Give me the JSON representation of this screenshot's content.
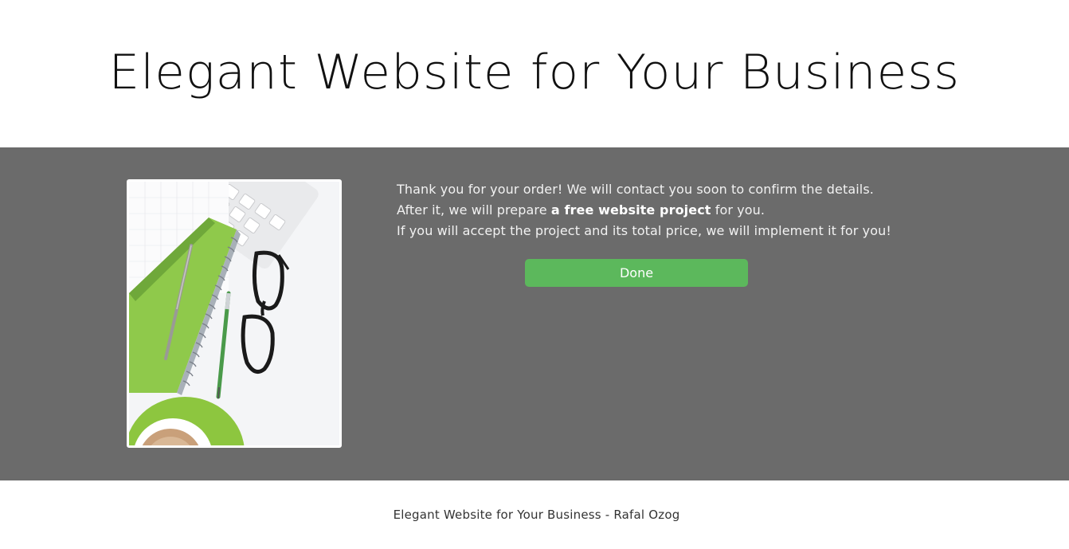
{
  "header": {
    "title": "Elegant Website for Your Business"
  },
  "main": {
    "message": {
      "line1": "Thank you for your order! We will contact you soon to confirm the details.",
      "line2_before": "After it, we will prepare ",
      "line2_bold": "a free website project",
      "line2_after": " for you.",
      "line3": "If you will accept the project and its total price, we will implement it for you!"
    },
    "done_button_label": "Done",
    "image": {
      "subject": "desk-photo-notebook-keyboard-glasses-pens-coffee"
    }
  },
  "footer": {
    "text": "Elegant Website for Your Business - Rafal Ozog"
  },
  "colors": {
    "main_background": "#6b6b6b",
    "button": "#5cb85c",
    "header_background": "#ffffff",
    "footer_text": "#333333"
  }
}
